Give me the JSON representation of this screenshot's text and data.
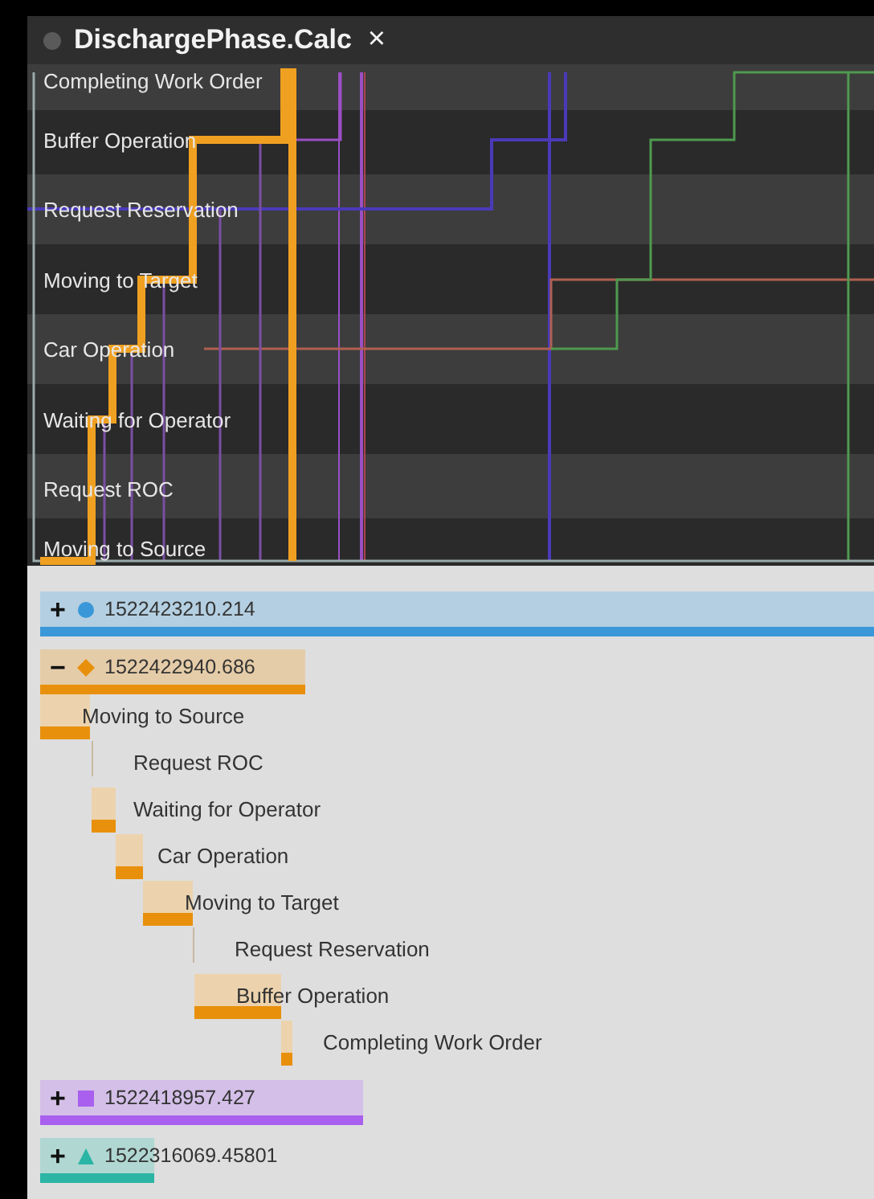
{
  "window": {
    "title": "DischargePhase.Calc",
    "close": "×"
  },
  "chart": {
    "y_labels": [
      "Completing Work Order",
      "Buffer Operation",
      "Request Reservation",
      "Moving to Target",
      "Car Operation",
      "Waiting for Operator",
      "Request ROC",
      "Moving to Source"
    ]
  },
  "groups": [
    {
      "toggle": "+",
      "id": "1522423210.214",
      "expanded": false,
      "kind": "circle",
      "color": "#3a98d8"
    },
    {
      "toggle": "−",
      "id": "1522422940.686",
      "expanded": true,
      "kind": "diamond",
      "color": "#e8900c",
      "children": [
        {
          "label": "Moving to Source"
        },
        {
          "label": "Request ROC"
        },
        {
          "label": "Waiting for Operator"
        },
        {
          "label": "Car Operation"
        },
        {
          "label": "Moving to Target"
        },
        {
          "label": "Request Reservation"
        },
        {
          "label": "Buffer Operation"
        },
        {
          "label": "Completing Work Order"
        }
      ]
    },
    {
      "toggle": "+",
      "id": "1522418957.427",
      "expanded": false,
      "kind": "square",
      "color": "#a960ee"
    },
    {
      "toggle": "+",
      "id": "1522316069.45801",
      "expanded": false,
      "kind": "triangle",
      "color": "#2ab5a5"
    }
  ]
}
